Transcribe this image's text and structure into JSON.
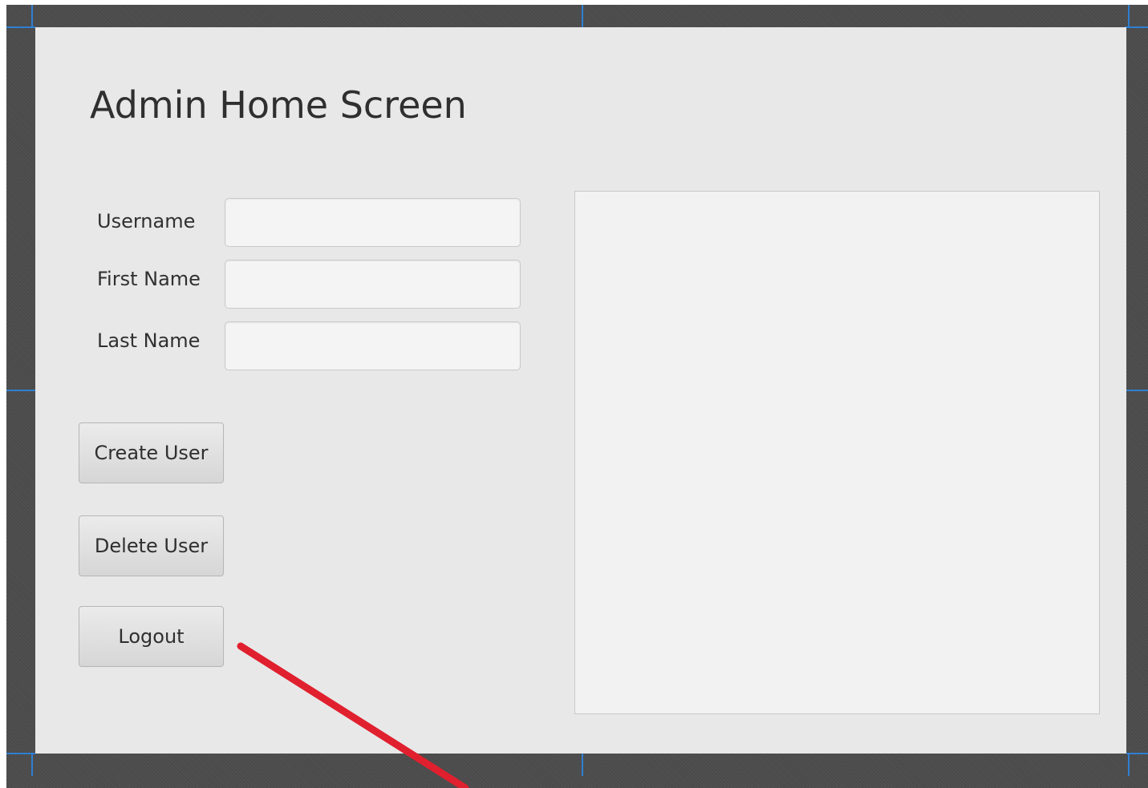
{
  "window": {
    "title": "Admin Home Screen"
  },
  "form": {
    "username": {
      "label": "Username",
      "value": ""
    },
    "first_name": {
      "label": "First Name",
      "value": ""
    },
    "last_name": {
      "label": "Last Name",
      "value": ""
    }
  },
  "actions": {
    "create_label": "Create User",
    "delete_label": "Delete User",
    "logout_label": "Logout"
  },
  "colors": {
    "backdrop": "#4a4a4a",
    "window_background": "#e8e8e8",
    "panel_background": "#f2f2f2",
    "guide_marks": "#2f7fd1",
    "annotation_arrow": "#e0202e"
  },
  "annotation": {
    "icon": "red-arrow-icon",
    "points_to": "logout-button"
  }
}
